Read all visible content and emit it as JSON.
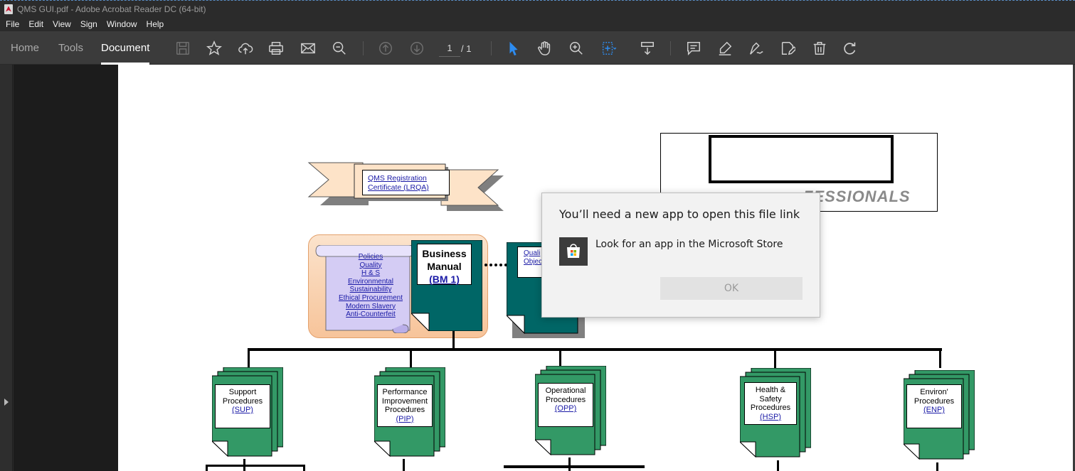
{
  "window": {
    "title": "QMS GUI.pdf - Adobe Acrobat Reader DC (64-bit)"
  },
  "menu": [
    "File",
    "Edit",
    "View",
    "Sign",
    "Window",
    "Help"
  ],
  "tabs": {
    "home": "Home",
    "tools": "Tools",
    "document": "Document"
  },
  "toolbar": {
    "page_current": "1",
    "page_total": "/ 1",
    "icons": [
      "save-icon",
      "star-icon",
      "upload-cloud-icon",
      "print-icon",
      "mail-icon",
      "zoom-out-icon",
      "page-up-icon",
      "page-down-icon",
      "select-cursor-icon",
      "hand-icon",
      "zoom-in-icon",
      "fit-page-icon",
      "scroll-mode-icon",
      "comment-icon",
      "highlight-icon",
      "sign-icon",
      "fill-sign-icon",
      "delete-icon",
      "rotate-icon"
    ]
  },
  "document": {
    "certificate": {
      "line1": "QMS Registration",
      "line2": "Certificate (LRQA)"
    },
    "brand_text": "FESSIONALS",
    "policies": [
      "Policies",
      "Quality",
      "H & S",
      "Environmental",
      "Sustainability",
      "Ethical Procurement",
      "Modern Slavery",
      "Anti-Counterfeit"
    ],
    "business_manual": {
      "line1": "Business",
      "line2": "Manual",
      "code": "(BM 1)"
    },
    "quality_objectives": {
      "line1": "Quali",
      "line2": "Objec"
    },
    "procedures": [
      {
        "lines": [
          "Support",
          "Procedures"
        ],
        "code": "(SUP)"
      },
      {
        "lines": [
          "Performance",
          "Improvement",
          "Procedures"
        ],
        "code": "(PIP)"
      },
      {
        "lines": [
          "Operational",
          "Procedures"
        ],
        "code": "(OPP)"
      },
      {
        "lines": [
          "Health &",
          "Safety",
          "Procedures"
        ],
        "code": "(HSP)"
      },
      {
        "lines": [
          "Environ'",
          "Procedures"
        ],
        "code": "(ENP)"
      }
    ]
  },
  "dialog": {
    "title": "You’ll need a new app to open this file link",
    "option": "Look for an app in the Microsoft Store",
    "ok_label": "OK"
  },
  "colors": {
    "teal": "#006666",
    "green": "#339966",
    "link": "#1a1aa6",
    "acrobat_blue": "#2d8cf0"
  }
}
